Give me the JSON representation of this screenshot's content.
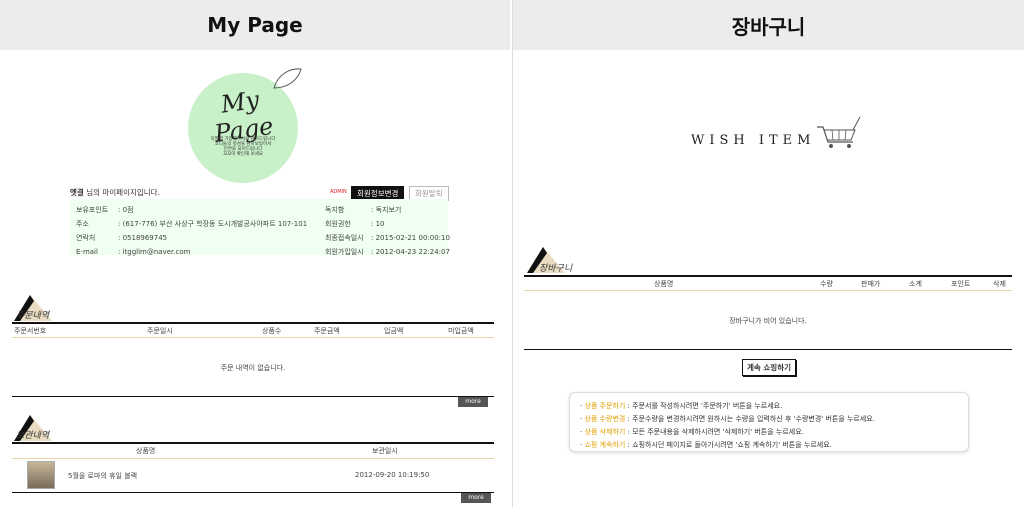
{
  "left": {
    "header": "My Page",
    "logo": {
      "script": "My Page",
      "lines": [
        "익멸뱀 가입해주셔서 감사드립니다",
        "코디들의 정성을 담아보았어서",
        "인연을 되어드립니다",
        "꼬꼬이 확인해 보세요"
      ]
    },
    "user": {
      "name": "엣결",
      "greeting": "님의 마이페이지입니다."
    },
    "admin_badge": "ADMIN",
    "buttons": {
      "edit": "회원정보변경",
      "withdraw": "회원탈퇴"
    },
    "info_left": [
      {
        "label": "보유포인트",
        "value": ": 0점"
      },
      {
        "label": "주소",
        "value": ": (617-776) 부산 사상구 학장동 도시개발공사아파트 107-101"
      },
      {
        "label": "연락처",
        "value": ": 0518969745"
      },
      {
        "label": "E-mail",
        "value": ": itgglim@naver.com"
      }
    ],
    "info_right": [
      {
        "label": "독지함",
        "value": ": 독지보기"
      },
      {
        "label": "회원권한",
        "value": ": 10"
      },
      {
        "label": "최종접속일시",
        "value": ": 2015-02-21 00:00:10"
      },
      {
        "label": "회원가입일시",
        "value": ": 2012-04-23 22:24:07"
      }
    ],
    "orders": {
      "title": "주문내역",
      "columns": [
        "주문서번호",
        "주문일시",
        "상품수",
        "주문금액",
        "입금액",
        "미입금액"
      ],
      "empty": "주문 내역이 없습니다.",
      "more": "more"
    },
    "wishlist": {
      "title": "보관내역",
      "columns": [
        "상품명",
        "보관일시"
      ],
      "items": [
        {
          "name": "5월을 로마의 휴일 블랙",
          "date": "2012-09-20 10:19:50"
        }
      ],
      "more": "more"
    }
  },
  "right": {
    "header": "장바구니",
    "wish_title": "WISH ITEM",
    "cart_title": "장바구니",
    "columns": [
      "상품명",
      "수량",
      "판매가",
      "소계",
      "포인트",
      "삭제"
    ],
    "empty": "장바구니가 비어 있습니다.",
    "continue": "계속 쇼핑하기",
    "help": [
      {
        "key": "상품 주문하기",
        "text": " : 주문서를 작성하시려면 '주문하기' 버튼을 누르세요."
      },
      {
        "key": "상품 수량변경",
        "text": " : 주문수량을 변경하시려면 원하시는 수량을 입력하신 후 '수량변경' 버튼을 누르세요."
      },
      {
        "key": "상품 삭제하기",
        "text": " : 모든 주문내용을 삭제하시려면 '삭제하기' 버튼을 누르세요."
      },
      {
        "key": "쇼핑 계속하기",
        "text": " : 쇼핑하시던 페이지로 돌아가시려면 '쇼핑 계속하기' 버튼을 누르세요."
      }
    ]
  }
}
